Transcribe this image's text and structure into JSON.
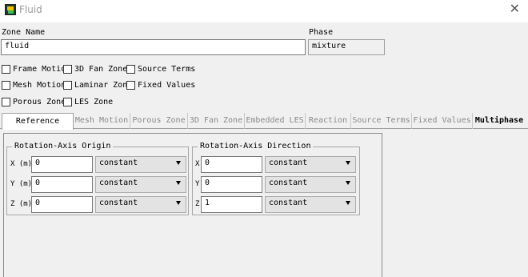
{
  "window": {
    "title": "Fluid",
    "close_glyph": "✕"
  },
  "zone_name": {
    "label": "Zone Name",
    "value": "fluid"
  },
  "phase": {
    "label": "Phase",
    "value": "mixture"
  },
  "options": [
    {
      "label": "Frame Motion",
      "checked": false
    },
    {
      "label": "3D Fan Zone",
      "checked": false
    },
    {
      "label": "Source Terms",
      "checked": false
    },
    {
      "label": "Mesh Motion",
      "checked": false
    },
    {
      "label": "Laminar Zone",
      "checked": false
    },
    {
      "label": "Fixed Values",
      "checked": false
    },
    {
      "label": "Porous Zone",
      "checked": false
    },
    {
      "label": "LES Zone",
      "checked": false
    }
  ],
  "tabs": [
    {
      "label": "Reference Frame",
      "active": true
    },
    {
      "label": "Mesh Motion"
    },
    {
      "label": "Porous Zone"
    },
    {
      "label": "3D Fan Zone"
    },
    {
      "label": "Embedded LES"
    },
    {
      "label": "Reaction"
    },
    {
      "label": "Source Terms"
    },
    {
      "label": "Fixed Values"
    },
    {
      "label": "Multiphase",
      "bold": true
    }
  ],
  "origin": {
    "title": "Rotation-Axis Origin",
    "rows": [
      {
        "axis": "X (m)",
        "value": "0",
        "method": "constant"
      },
      {
        "axis": "Y (m)",
        "value": "0",
        "method": "constant"
      },
      {
        "axis": "Z (m)",
        "value": "0",
        "method": "constant"
      }
    ]
  },
  "direction": {
    "title": "Rotation-Axis Direction",
    "rows": [
      {
        "axis": "X",
        "value": "0",
        "method": "constant"
      },
      {
        "axis": "Y",
        "value": "0",
        "method": "constant"
      },
      {
        "axis": "Z",
        "value": "1",
        "method": "constant"
      }
    ]
  }
}
